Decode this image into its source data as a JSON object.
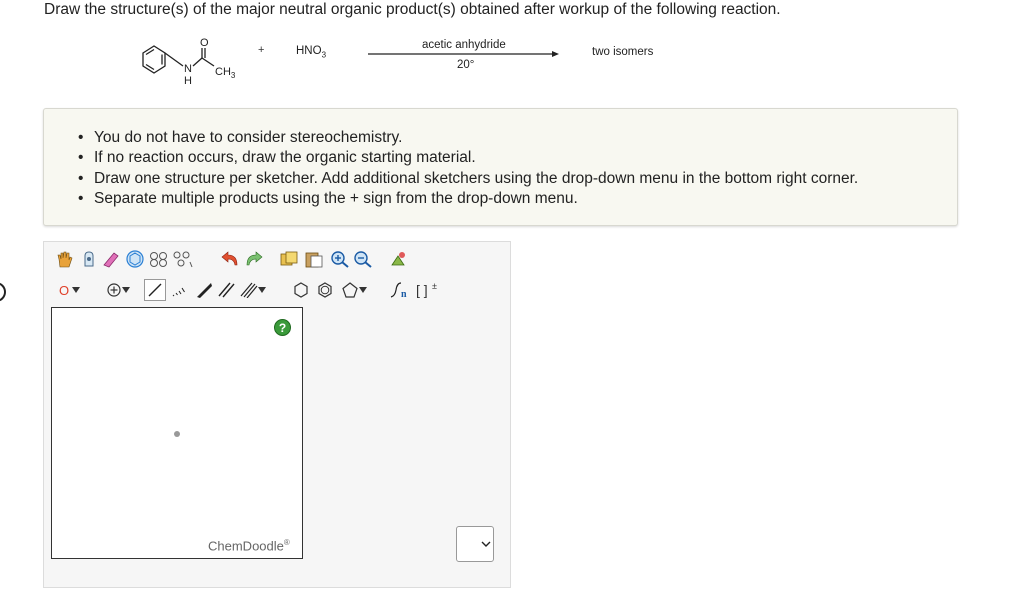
{
  "question": "Draw the structure(s) of the major neutral organic product(s) obtained after workup of the following reaction.",
  "reaction": {
    "reactant_atoms": {
      "oxygen": "O",
      "nitrogen": "N",
      "hydrogen": "H",
      "methyl_c": "CH",
      "methyl_h": "3"
    },
    "plus": "+",
    "reagent": "HNO",
    "reagent_sub": "3",
    "condition_top": "acetic anhydride",
    "condition_bottom": "20°",
    "product_text": "two isomers"
  },
  "instructions": [
    "You do not have to consider stereochemistry.",
    "If no reaction occurs, draw the organic starting material.",
    "Draw one structure per sketcher. Add additional sketchers using the drop-down menu in the bottom right corner.",
    "Separate multiple products using the + sign from the drop-down menu."
  ],
  "sketcher": {
    "help_label": "?",
    "brand": "ChemDoodle",
    "brand_mark": "®",
    "atom_label": "O",
    "colors": {
      "accent": "#2a7fd4",
      "help": "#3a9a3a",
      "atom": "#e0402a"
    }
  }
}
